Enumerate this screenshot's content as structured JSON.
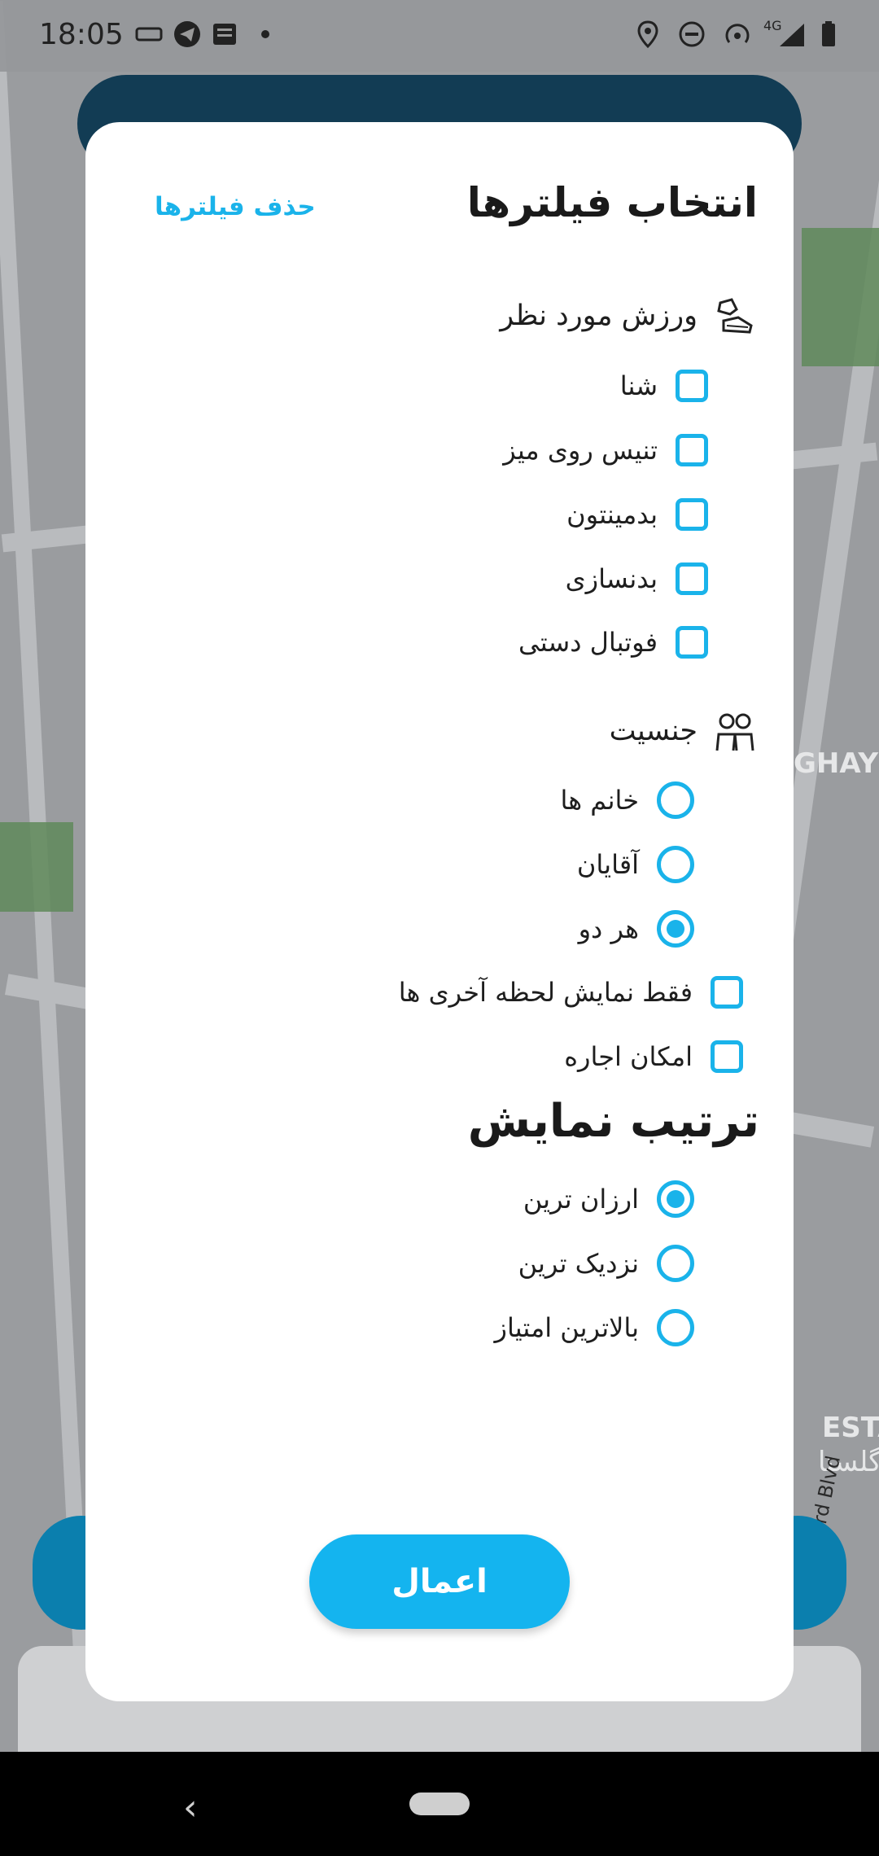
{
  "status_bar": {
    "time": "18:05",
    "network": "4G"
  },
  "map": {
    "labels": [
      "GHAYE",
      "ESTAN",
      "گلستا",
      "Nabard Blvd"
    ]
  },
  "dialog": {
    "title": "انتخاب فیلترها",
    "clear_filters": "حذف فیلترها",
    "sports": {
      "title": "ورزش مورد نظر",
      "icon": "sneakers-icon",
      "options": [
        {
          "label": "شنا",
          "checked": false
        },
        {
          "label": "تنیس روی میز",
          "checked": false
        },
        {
          "label": "بدمینتون",
          "checked": false
        },
        {
          "label": "بدنسازی",
          "checked": false
        },
        {
          "label": "فوتبال دستی",
          "checked": false
        }
      ]
    },
    "gender": {
      "title": "جنسیت",
      "icon": "couple-icon",
      "options": [
        {
          "label": "خانم ها",
          "selected": false
        },
        {
          "label": "آقایان",
          "selected": false
        },
        {
          "label": "هر دو",
          "selected": true
        }
      ]
    },
    "extras": [
      {
        "label": "فقط نمایش لحظه آخری ها",
        "checked": false
      },
      {
        "label": "امکان اجاره",
        "checked": false
      }
    ],
    "sort": {
      "title": "ترتیب نمایش",
      "options": [
        {
          "label": "ارزان ترین",
          "selected": true
        },
        {
          "label": "نزدیک ترین",
          "selected": false
        },
        {
          "label": "بالاترین امتیاز",
          "selected": false
        }
      ]
    },
    "apply_button": "اعمال"
  },
  "colors": {
    "accent": "#1ab3ea",
    "header": "#123c54",
    "dialog_bg": "#ffffff"
  }
}
